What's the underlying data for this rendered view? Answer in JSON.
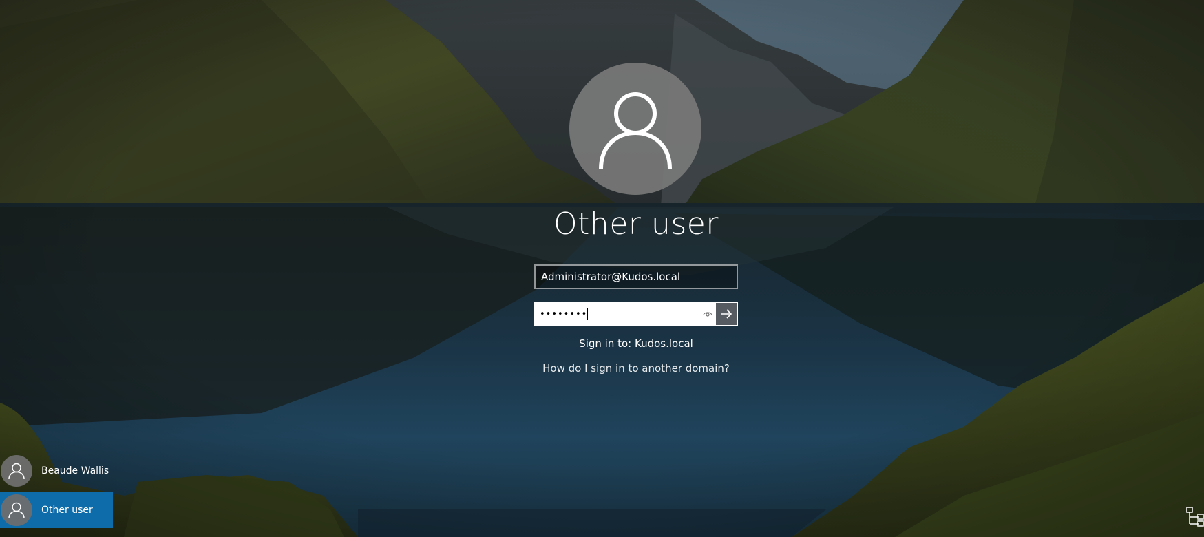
{
  "login": {
    "account_title": "Other user",
    "username_value": "Administrator@Kudos.local",
    "password_mask": "••••••••",
    "sign_in_to": "Sign in to: Kudos.local",
    "domain_help": "How do I sign in to another domain?"
  },
  "user_list": [
    {
      "name": "Beaude Wallis",
      "selected": false
    },
    {
      "name": "Other user",
      "selected": true
    }
  ],
  "icons": {
    "avatar": "person-icon",
    "reveal": "eye-icon",
    "submit": "arrow-right-icon",
    "network": "network-icon"
  },
  "colors": {
    "selected_user_bg": "#0f6cab",
    "submit_bg": "#555b60"
  }
}
